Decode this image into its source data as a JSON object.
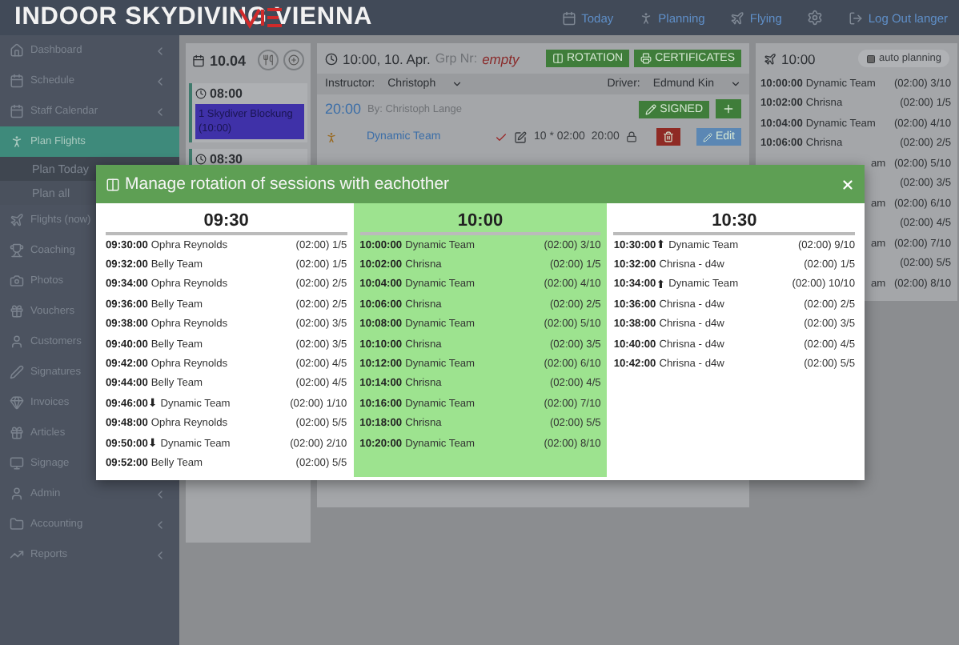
{
  "header": {
    "brand": "INDOOR SKYDIVING VIENNA",
    "nav": [
      {
        "label": "Today"
      },
      {
        "label": "Planning"
      },
      {
        "label": "Flying"
      },
      {
        "label": "Log Out langer"
      }
    ]
  },
  "sidebar": {
    "items": [
      {
        "label": "Dashboard",
        "selected": false,
        "chevron": true
      },
      {
        "label": "Schedule",
        "selected": false,
        "chevron": true
      },
      {
        "label": "Staff Calendar",
        "selected": false,
        "chevron": true
      },
      {
        "label": "Plan Flights",
        "selected": true,
        "chevron": false,
        "children": [
          {
            "label": "Plan Today",
            "selected": true
          },
          {
            "label": "Plan all",
            "selected": false
          }
        ]
      },
      {
        "label": "Flights (now)",
        "selected": false,
        "chevron": false
      },
      {
        "label": "Coaching",
        "selected": false,
        "chevron": false
      },
      {
        "label": "Photos",
        "selected": false,
        "chevron": false
      },
      {
        "label": "Vouchers",
        "selected": false,
        "chevron": false
      },
      {
        "label": "Customers",
        "selected": false,
        "chevron": false
      },
      {
        "label": "Signatures",
        "selected": false,
        "chevron": false
      },
      {
        "label": "Invoices",
        "selected": false,
        "chevron": false
      },
      {
        "label": "Articles",
        "selected": false,
        "chevron": false
      },
      {
        "label": "Signage",
        "selected": false,
        "chevron": false
      },
      {
        "label": "Admin",
        "selected": false,
        "chevron": true
      },
      {
        "label": "Accounting",
        "selected": false,
        "chevron": true
      },
      {
        "label": "Reports",
        "selected": false,
        "chevron": true
      }
    ]
  },
  "day": {
    "date": "10.04",
    "slots": [
      {
        "time": "08:00",
        "blocks": [
          "1 Skydiver Blockung (10:00)"
        ]
      },
      {
        "time": "08:30"
      }
    ]
  },
  "session_panel": {
    "title": "10:00, 10. Apr.",
    "group_label": "Grp Nr:",
    "group_value": "empty",
    "buttons": [
      "ROTATION",
      "CERTIFICATES"
    ],
    "instructor_label": "Instructor:",
    "instructor": "Christoph",
    "driver_label": "Driver:",
    "driver": "Edmund Kin",
    "flight": {
      "time": "20:00",
      "by": "By: Christoph Lange",
      "status": "SIGNED"
    },
    "booking": {
      "name": "Dynamic Team",
      "checked": true,
      "duration": "10 * 02:00",
      "end": "20:00",
      "edit": "Edit"
    }
  },
  "plan_panel": {
    "time": "10:00",
    "auto_button": "auto planning",
    "rows": [
      {
        "time": "10:00:00",
        "name": "Dynamic Team",
        "info": "(02:00) 3/10"
      },
      {
        "time": "10:02:00",
        "name": "Chrisna",
        "info": "(02:00) 1/5"
      },
      {
        "time": "10:04:00",
        "name": "Dynamic Team",
        "info": "(02:00) 4/10"
      },
      {
        "time": "10:06:00",
        "name": "Chrisna",
        "info": "(02:00) 2/5"
      },
      {
        "name": "am",
        "info": "(02:00) 5/10"
      },
      {
        "info": "(02:00) 3/5"
      },
      {
        "name": "am",
        "info": "(02:00) 6/10"
      },
      {
        "info": "(02:00) 4/5"
      },
      {
        "name": "am",
        "info": "(02:00) 7/10"
      },
      {
        "info": "(02:00) 5/5"
      },
      {
        "name": "am",
        "info": "(02:00) 8/10"
      }
    ]
  },
  "modal": {
    "title": "Manage rotation of sessions with eachother",
    "columns": [
      {
        "time": "09:30",
        "selected": false,
        "rows": [
          {
            "time": "09:30:00",
            "name": "Ophra Reynolds",
            "info": "(02:00) 1/5"
          },
          {
            "time": "09:32:00",
            "name": "Belly Team",
            "info": "(02:00) 1/5"
          },
          {
            "time": "09:34:00",
            "name": "Ophra Reynolds",
            "info": "(02:00) 2/5"
          },
          {
            "time": "09:36:00",
            "name": "Belly Team",
            "info": "(02:00) 2/5"
          },
          {
            "time": "09:38:00",
            "name": "Ophra Reynolds",
            "info": "(02:00) 3/5"
          },
          {
            "time": "09:40:00",
            "name": "Belly Team",
            "info": "(02:00) 3/5"
          },
          {
            "time": "09:42:00",
            "name": "Ophra Reynolds",
            "info": "(02:00) 4/5"
          },
          {
            "time": "09:44:00",
            "name": "Belly Team",
            "info": "(02:00) 4/5"
          },
          {
            "time": "09:46:00",
            "arrow": "⬇",
            "name": "Dynamic Team",
            "info": "(02:00) 1/10"
          },
          {
            "time": "09:48:00",
            "name": "Ophra Reynolds",
            "info": "(02:00) 5/5"
          },
          {
            "time": "09:50:00",
            "arrow": "⬇",
            "name": "Dynamic Team",
            "info": "(02:00) 2/10"
          },
          {
            "time": "09:52:00",
            "name": "Belly Team",
            "info": "(02:00) 5/5"
          }
        ]
      },
      {
        "time": "10:00",
        "selected": true,
        "rows": [
          {
            "time": "10:00:00",
            "name": "Dynamic Team",
            "info": "(02:00) 3/10"
          },
          {
            "time": "10:02:00",
            "name": "Chrisna",
            "info": "(02:00) 1/5"
          },
          {
            "time": "10:04:00",
            "name": "Dynamic Team",
            "info": "(02:00) 4/10"
          },
          {
            "time": "10:06:00",
            "name": "Chrisna",
            "info": "(02:00) 2/5"
          },
          {
            "time": "10:08:00",
            "name": "Dynamic Team",
            "info": "(02:00) 5/10"
          },
          {
            "time": "10:10:00",
            "name": "Chrisna",
            "info": "(02:00) 3/5"
          },
          {
            "time": "10:12:00",
            "name": "Dynamic Team",
            "info": "(02:00) 6/10"
          },
          {
            "time": "10:14:00",
            "name": "Chrisna",
            "info": "(02:00) 4/5"
          },
          {
            "time": "10:16:00",
            "name": "Dynamic Team",
            "info": "(02:00) 7/10"
          },
          {
            "time": "10:18:00",
            "name": "Chrisna",
            "info": "(02:00) 5/5"
          },
          {
            "time": "10:20:00",
            "name": "Dynamic Team",
            "info": "(02:00) 8/10"
          }
        ]
      },
      {
        "time": "10:30",
        "selected": false,
        "rows": [
          {
            "time": "10:30:00",
            "arrow": "⬆",
            "name": "Dynamic Team",
            "info": "(02:00) 9/10"
          },
          {
            "time": "10:32:00",
            "name": "Chrisna - d4w",
            "info": "(02:00) 1/5"
          },
          {
            "time": "10:34:00",
            "arrow": "⬆",
            "name": "Dynamic Team",
            "info": "(02:00) 10/10"
          },
          {
            "time": "10:36:00",
            "name": "Chrisna - d4w",
            "info": "(02:00) 2/5"
          },
          {
            "time": "10:38:00",
            "name": "Chrisna - d4w",
            "info": "(02:00) 3/5"
          },
          {
            "time": "10:40:00",
            "name": "Chrisna - d4w",
            "info": "(02:00) 4/5"
          },
          {
            "time": "10:42:00",
            "name": "Chrisna - d4w",
            "info": "(02:00) 5/5"
          }
        ]
      }
    ]
  }
}
